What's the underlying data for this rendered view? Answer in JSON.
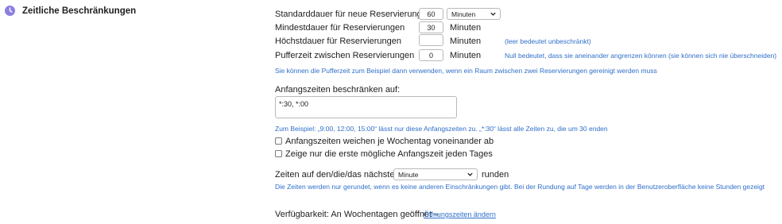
{
  "section": {
    "title": "Zeitliche Beschränkungen",
    "icon": "clock-icon",
    "icon_color": "#8b7fe0"
  },
  "fields": {
    "default_duration": {
      "label": "Standarddauer für neue Reservierungen",
      "value": "60",
      "unit_selected": "Minuten"
    },
    "min_duration": {
      "label": "Mindestdauer für Reservierungen",
      "value": "30",
      "unit": "Minuten"
    },
    "max_duration": {
      "label": "Höchstdauer für Reservierungen",
      "value": "",
      "unit": "Minuten",
      "hint": "(leer bedeutet unbeschränkt)"
    },
    "buffer_time": {
      "label": "Pufferzeit zwischen Reservierungen",
      "value": "0",
      "unit": "Minuten",
      "hint": "Null bedeutet, dass sie aneinander angrenzen können (sie können sich nie überschneiden)"
    },
    "buffer_note": "Sie können die Pufferzeit zum Beispiel dann verwenden, wenn ein Raum zwischen zwei Reservierungen gereinigt werden muss"
  },
  "start_times": {
    "label": "Anfangszeiten beschränken auf:",
    "value": "*:30, *:00",
    "hint": "Zum Beispiel: „9:00, 12:00, 15:00“ lässt nur diese Anfangszeiten zu. „*:30“ lässt alle Zeiten zu, die um 30 enden",
    "checkbox_weekday": "Anfangszeiten weichen je Wochentag voneinander ab",
    "checkbox_first": "Zeige nur die erste mögliche Anfangszeit jeden Tages"
  },
  "rounding": {
    "prefix": "Zeiten auf den/die/das nächste(n)",
    "selected": "Minute",
    "suffix": "runden",
    "hint": "Die Zeiten werden nur gerundet, wenn es keine anderen Einschränkungen gibt. Bei der Rundung auf Tage werden in der Benutzeroberfläche keine Stunden gezeigt"
  },
  "availability": {
    "text": "Verfügbarkeit: An Wochentagen geöffnet –",
    "link": "Öffnungszeiten ändern"
  },
  "colors": {
    "accent": "#2f6fc9"
  }
}
